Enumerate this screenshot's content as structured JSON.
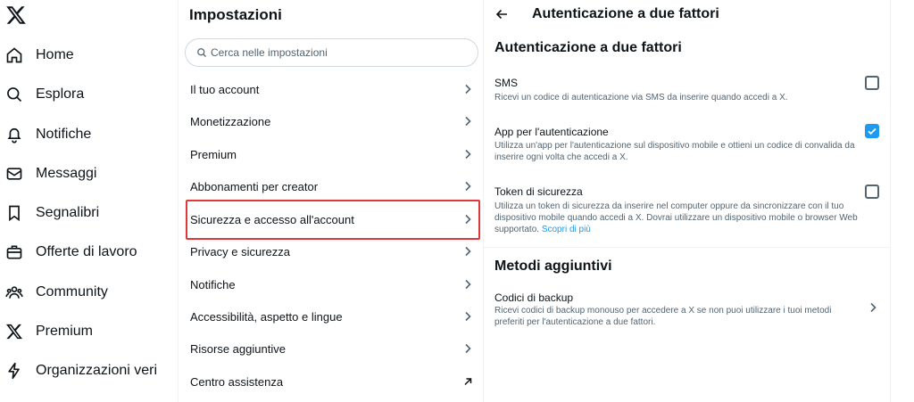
{
  "nav": {
    "logo_icon": "x-logo-icon",
    "items": [
      {
        "label": "Home",
        "icon": "home-icon"
      },
      {
        "label": "Esplora",
        "icon": "search-icon"
      },
      {
        "label": "Notifiche",
        "icon": "bell-icon"
      },
      {
        "label": "Messaggi",
        "icon": "envelope-icon"
      },
      {
        "label": "Segnalibri",
        "icon": "bookmark-icon"
      },
      {
        "label": "Offerte di lavoro",
        "icon": "briefcase-icon"
      },
      {
        "label": "Community",
        "icon": "community-icon"
      },
      {
        "label": "Premium",
        "icon": "x-logo-icon"
      },
      {
        "label": "Organizzazioni veri",
        "icon": "lightning-icon"
      }
    ]
  },
  "settings": {
    "title": "Impostazioni",
    "search_placeholder": "Cerca nelle impostazioni",
    "items": [
      {
        "label": "Il tuo account"
      },
      {
        "label": "Monetizzazione"
      },
      {
        "label": "Premium"
      },
      {
        "label": "Abbonamenti per creator"
      },
      {
        "label": "Sicurezza e accesso all'account",
        "highlighted": true
      },
      {
        "label": "Privacy e sicurezza"
      },
      {
        "label": "Notifiche"
      },
      {
        "label": "Accessibilità, aspetto e lingue"
      },
      {
        "label": "Risorse aggiuntive"
      },
      {
        "label": "Centro assistenza",
        "external": true
      }
    ],
    "highlight_color": "#e0383a"
  },
  "panel": {
    "header_title": "Autenticazione a due fattori",
    "section_title": "Autenticazione a due fattori",
    "options": [
      {
        "title": "SMS",
        "desc": "Ricevi un codice di autenticazione via SMS da inserire quando accedi a X.",
        "checked": false
      },
      {
        "title": "App per l'autenticazione",
        "desc": "Utilizza un'app per l'autenticazione sul dispositivo mobile e ottieni un codice di convalida da inserire ogni volta che accedi a X.",
        "checked": true
      },
      {
        "title": "Token di sicurezza",
        "desc": "Utilizza un token di sicurezza da inserire nel computer oppure da sincronizzare con il tuo dispositivo mobile quando accedi a X. Dovrai utilizzare un dispositivo mobile o browser Web supportato.",
        "link": "Scopri di più",
        "checked": false
      }
    ],
    "additional_title": "Metodi aggiuntivi",
    "backup": {
      "title": "Codici di backup",
      "desc": "Ricevi codici di backup monouso per accedere a X se non puoi utilizzare i tuoi metodi preferiti per l'autenticazione a due fattori."
    },
    "accent_color": "#1d9bf0"
  }
}
